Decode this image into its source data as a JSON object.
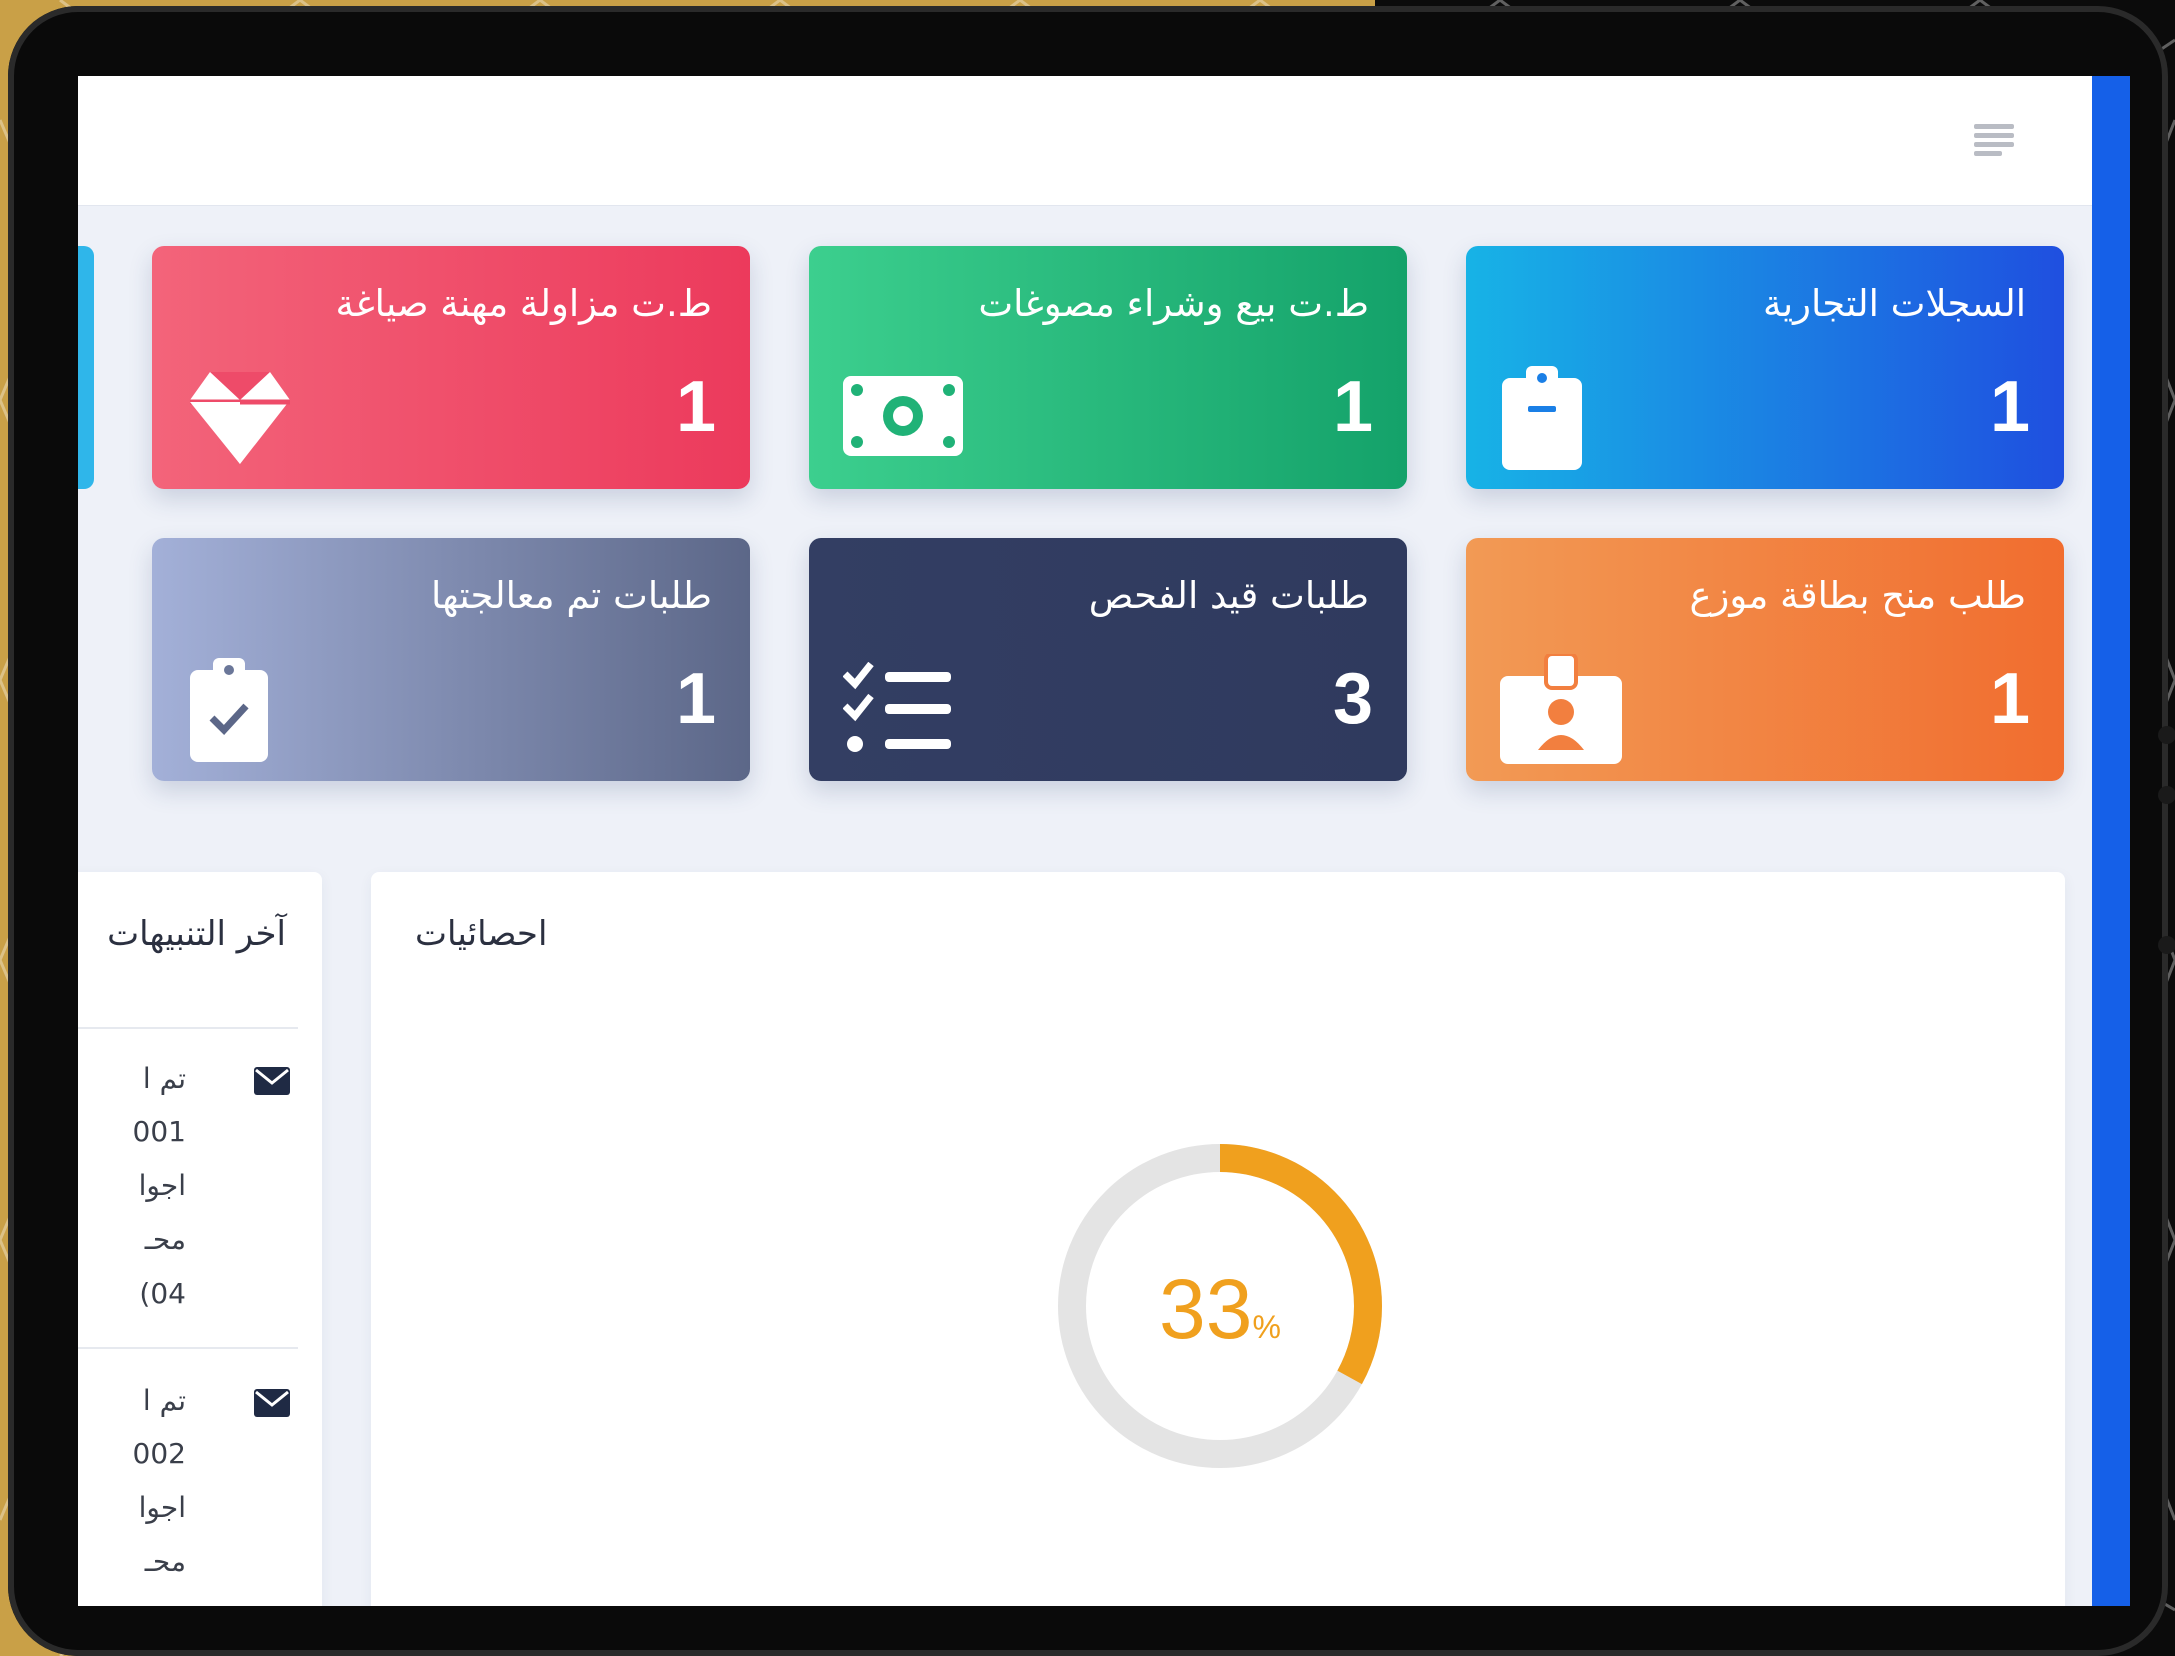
{
  "colors": {
    "backdrop_gold": "#c9a047",
    "accent_blue": "#1560e8",
    "donut_progress": "#f0a01e",
    "donut_track": "#e4e4e4"
  },
  "header": {
    "menu_icon": "hamburger-menu-icon"
  },
  "cards": [
    {
      "title": "السجلات التجارية",
      "count": "1",
      "icon": "clipboard-icon",
      "color_from": "#1f4fe0",
      "color_to": "#17b3e6"
    },
    {
      "title": "ط.ت بيع وشراء مصوغات",
      "count": "1",
      "icon": "money-bill-icon",
      "color_from": "#14a26a",
      "color_to": "#3ccf8e"
    },
    {
      "title": "ط.ت مزاولة مهنة صياغة",
      "count": "1",
      "icon": "diamond-icon",
      "color_from": "#ec3a5c",
      "color_to": "#f3647a"
    },
    {
      "title": "طلب منح بطاقة موزع",
      "count": "1",
      "icon": "id-badge-icon",
      "color_from": "#f16d2f",
      "color_to": "#f29a55"
    },
    {
      "title": "طلبات قيد الفحص",
      "count": "3",
      "icon": "checklist-icon",
      "color_from": "#2f3a5e",
      "color_to": "#333e63"
    },
    {
      "title": "طلبات تم معالجتها",
      "count": "1",
      "icon": "clipboard-check-icon",
      "color_from": "#5c6788",
      "color_to": "#a3b0d8"
    }
  ],
  "statistics": {
    "title": "احصائيات",
    "percent_value": "33",
    "percent_sign": "%",
    "fraction": 0.33
  },
  "notifications": {
    "title": "آخر التنبيهات",
    "items": [
      {
        "icon": "envelope-icon",
        "lines": [
          "تم ا",
          "001",
          "اجوا",
          "محـ",
          "04)"
        ]
      },
      {
        "icon": "envelope-icon",
        "lines": [
          "تم ا",
          "002",
          "اجوا",
          "محـ"
        ]
      }
    ]
  }
}
